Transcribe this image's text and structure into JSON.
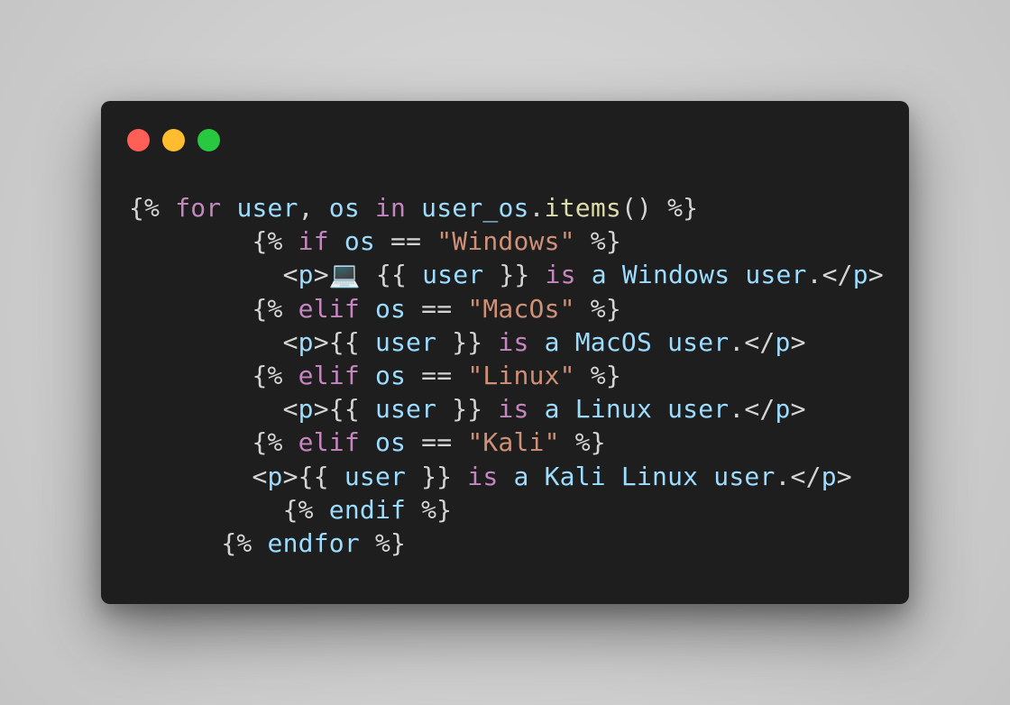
{
  "window": {
    "controls": [
      "close",
      "minimize",
      "maximize"
    ],
    "colors": {
      "close": "#ff5f57",
      "minimize": "#febc2e",
      "maximize": "#28c840",
      "background": "#1e1e1e"
    }
  },
  "code": {
    "lines": [
      {
        "indent": "",
        "tokens": [
          {
            "text": "{%",
            "type": "punc"
          },
          {
            "text": " ",
            "type": "punc"
          },
          {
            "text": "for",
            "type": "kw"
          },
          {
            "text": " ",
            "type": "punc"
          },
          {
            "text": "user",
            "type": "var"
          },
          {
            "text": ", ",
            "type": "punc"
          },
          {
            "text": "os",
            "type": "var"
          },
          {
            "text": " ",
            "type": "punc"
          },
          {
            "text": "in",
            "type": "kw"
          },
          {
            "text": " ",
            "type": "punc"
          },
          {
            "text": "user_os",
            "type": "var"
          },
          {
            "text": ".",
            "type": "punc"
          },
          {
            "text": "items",
            "type": "fn"
          },
          {
            "text": "() %}",
            "type": "punc"
          }
        ]
      },
      {
        "indent": "        ",
        "tokens": [
          {
            "text": "{%",
            "type": "punc"
          },
          {
            "text": " ",
            "type": "punc"
          },
          {
            "text": "if",
            "type": "kw"
          },
          {
            "text": " ",
            "type": "punc"
          },
          {
            "text": "os",
            "type": "var"
          },
          {
            "text": " == ",
            "type": "punc"
          },
          {
            "text": "\"Windows\"",
            "type": "str"
          },
          {
            "text": " %}",
            "type": "punc"
          }
        ]
      },
      {
        "indent": "          ",
        "tokens": [
          {
            "text": "<",
            "type": "punc"
          },
          {
            "text": "p",
            "type": "tag"
          },
          {
            "text": ">",
            "type": "punc"
          },
          {
            "text": "💻",
            "type": "punc"
          },
          {
            "text": " {{ ",
            "type": "punc"
          },
          {
            "text": "user",
            "type": "var"
          },
          {
            "text": " }} ",
            "type": "punc"
          },
          {
            "text": "is",
            "type": "kw"
          },
          {
            "text": " ",
            "type": "punc"
          },
          {
            "text": "a",
            "type": "text"
          },
          {
            "text": " ",
            "type": "punc"
          },
          {
            "text": "Windows",
            "type": "text"
          },
          {
            "text": " ",
            "type": "punc"
          },
          {
            "text": "user",
            "type": "text"
          },
          {
            "text": ".</",
            "type": "punc"
          },
          {
            "text": "p",
            "type": "tag"
          },
          {
            "text": ">",
            "type": "punc"
          }
        ]
      },
      {
        "indent": "        ",
        "tokens": [
          {
            "text": "{%",
            "type": "punc"
          },
          {
            "text": " ",
            "type": "punc"
          },
          {
            "text": "elif",
            "type": "kw"
          },
          {
            "text": " ",
            "type": "punc"
          },
          {
            "text": "os",
            "type": "var"
          },
          {
            "text": " == ",
            "type": "punc"
          },
          {
            "text": "\"MacOs\"",
            "type": "str"
          },
          {
            "text": " %}",
            "type": "punc"
          }
        ]
      },
      {
        "indent": "          ",
        "tokens": [
          {
            "text": "<",
            "type": "punc"
          },
          {
            "text": "p",
            "type": "tag"
          },
          {
            "text": ">{{ ",
            "type": "punc"
          },
          {
            "text": "user",
            "type": "var"
          },
          {
            "text": " }} ",
            "type": "punc"
          },
          {
            "text": "is",
            "type": "kw"
          },
          {
            "text": " ",
            "type": "punc"
          },
          {
            "text": "a",
            "type": "text"
          },
          {
            "text": " ",
            "type": "punc"
          },
          {
            "text": "MacOS",
            "type": "text"
          },
          {
            "text": " ",
            "type": "punc"
          },
          {
            "text": "user",
            "type": "text"
          },
          {
            "text": ".</",
            "type": "punc"
          },
          {
            "text": "p",
            "type": "tag"
          },
          {
            "text": ">",
            "type": "punc"
          }
        ]
      },
      {
        "indent": "        ",
        "tokens": [
          {
            "text": "{%",
            "type": "punc"
          },
          {
            "text": " ",
            "type": "punc"
          },
          {
            "text": "elif",
            "type": "kw"
          },
          {
            "text": " ",
            "type": "punc"
          },
          {
            "text": "os",
            "type": "var"
          },
          {
            "text": " == ",
            "type": "punc"
          },
          {
            "text": "\"Linux\"",
            "type": "str"
          },
          {
            "text": " %}",
            "type": "punc"
          }
        ]
      },
      {
        "indent": "          ",
        "tokens": [
          {
            "text": "<",
            "type": "punc"
          },
          {
            "text": "p",
            "type": "tag"
          },
          {
            "text": ">{{ ",
            "type": "punc"
          },
          {
            "text": "user",
            "type": "var"
          },
          {
            "text": " }} ",
            "type": "punc"
          },
          {
            "text": "is",
            "type": "kw"
          },
          {
            "text": " ",
            "type": "punc"
          },
          {
            "text": "a",
            "type": "text"
          },
          {
            "text": " ",
            "type": "punc"
          },
          {
            "text": "Linux",
            "type": "text"
          },
          {
            "text": " ",
            "type": "punc"
          },
          {
            "text": "user",
            "type": "text"
          },
          {
            "text": ".</",
            "type": "punc"
          },
          {
            "text": "p",
            "type": "tag"
          },
          {
            "text": ">",
            "type": "punc"
          }
        ]
      },
      {
        "indent": "        ",
        "tokens": [
          {
            "text": "{%",
            "type": "punc"
          },
          {
            "text": " ",
            "type": "punc"
          },
          {
            "text": "elif",
            "type": "kw"
          },
          {
            "text": " ",
            "type": "punc"
          },
          {
            "text": "os",
            "type": "var"
          },
          {
            "text": " == ",
            "type": "punc"
          },
          {
            "text": "\"Kali\"",
            "type": "str"
          },
          {
            "text": " %}",
            "type": "punc"
          }
        ]
      },
      {
        "indent": "        ",
        "tokens": [
          {
            "text": "<",
            "type": "punc"
          },
          {
            "text": "p",
            "type": "tag"
          },
          {
            "text": ">{{ ",
            "type": "punc"
          },
          {
            "text": "user",
            "type": "var"
          },
          {
            "text": " }} ",
            "type": "punc"
          },
          {
            "text": "is",
            "type": "kw"
          },
          {
            "text": " ",
            "type": "punc"
          },
          {
            "text": "a",
            "type": "text"
          },
          {
            "text": " ",
            "type": "punc"
          },
          {
            "text": "Kali",
            "type": "text"
          },
          {
            "text": " ",
            "type": "punc"
          },
          {
            "text": "Linux",
            "type": "text"
          },
          {
            "text": " ",
            "type": "punc"
          },
          {
            "text": "user",
            "type": "text"
          },
          {
            "text": ".</",
            "type": "punc"
          },
          {
            "text": "p",
            "type": "tag"
          },
          {
            "text": ">",
            "type": "punc"
          }
        ]
      },
      {
        "indent": "          ",
        "tokens": [
          {
            "text": "{%",
            "type": "punc"
          },
          {
            "text": " ",
            "type": "punc"
          },
          {
            "text": "endif",
            "type": "var"
          },
          {
            "text": " %}",
            "type": "punc"
          }
        ]
      },
      {
        "indent": "      ",
        "tokens": [
          {
            "text": "{%",
            "type": "punc"
          },
          {
            "text": " ",
            "type": "punc"
          },
          {
            "text": "endfor",
            "type": "var"
          },
          {
            "text": " %}",
            "type": "punc"
          }
        ]
      }
    ]
  }
}
